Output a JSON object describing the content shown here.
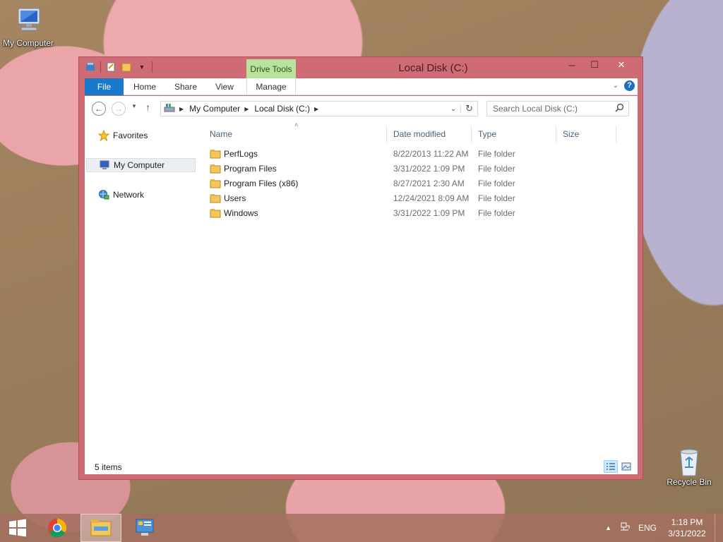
{
  "desktop": {
    "icons": [
      {
        "label": "My Computer",
        "icon": "computer-icon"
      },
      {
        "label": "Recycle Bin",
        "icon": "recycle-bin-icon"
      }
    ]
  },
  "window": {
    "title": "Local Disk (C:)",
    "contextual_tab_group": "Drive Tools",
    "controls": {
      "minimize": "─",
      "maximize": "☐",
      "close": "✕"
    },
    "ribbon_tabs": [
      "File",
      "Home",
      "Share",
      "View",
      "Manage"
    ],
    "address": {
      "crumbs": [
        "My Computer",
        "Local Disk (C:)"
      ]
    },
    "search": {
      "placeholder": "Search Local Disk (C:)"
    },
    "nav_pane": [
      {
        "label": "Favorites",
        "icon": "star-icon"
      },
      {
        "label": "My Computer",
        "icon": "computer-icon",
        "selected": true
      },
      {
        "label": "Network",
        "icon": "network-icon"
      }
    ],
    "columns": [
      "Name",
      "Date modified",
      "Type",
      "Size"
    ],
    "files": [
      {
        "name": "PerfLogs",
        "date": "8/22/2013 11:22 AM",
        "type": "File folder"
      },
      {
        "name": "Program Files",
        "date": "3/31/2022 1:09 PM",
        "type": "File folder"
      },
      {
        "name": "Program Files (x86)",
        "date": "8/27/2021 2:30 AM",
        "type": "File folder"
      },
      {
        "name": "Users",
        "date": "12/24/2021 8:09 AM",
        "type": "File folder"
      },
      {
        "name": "Windows",
        "date": "3/31/2022 1:09 PM",
        "type": "File folder"
      }
    ],
    "status": {
      "item_count": "5 items"
    }
  },
  "taskbar": {
    "apps": [
      {
        "name": "start-button",
        "icon": "windows-logo-icon"
      },
      {
        "name": "chrome",
        "icon": "chrome-icon"
      },
      {
        "name": "file-explorer",
        "icon": "folder-icon",
        "active": true
      },
      {
        "name": "control-panel",
        "icon": "control-panel-icon"
      }
    ],
    "tray": {
      "language": "ENG",
      "time": "1:18 PM",
      "date": "3/31/2022"
    }
  },
  "colors": {
    "window_frame": "#cf6b75",
    "file_tab": "#1979ca",
    "drive_tools": "#b9e39a",
    "folder": "#e8b84b"
  }
}
